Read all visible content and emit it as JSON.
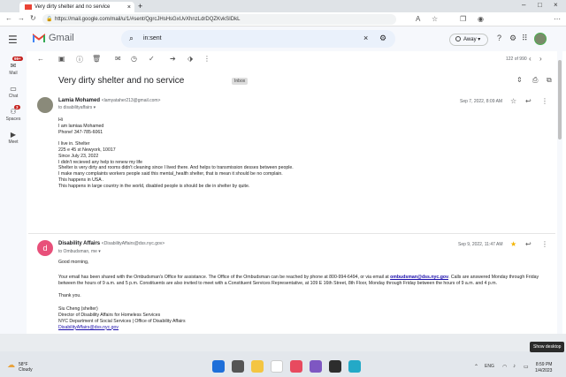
{
  "browser": {
    "tab_title": "Very dirty shelter and no service",
    "url": "https://mail.google.com/mail/u/1/#sent/QgrcJHsHsGxUvXhnzLdrDQZKvkSIDkL"
  },
  "gmail": {
    "product_name": "Gmail",
    "search_query": "in:sent",
    "status_label": "Away",
    "rail": {
      "mail_label": "Mail",
      "mail_badge": "99+",
      "chat_label": "Chat",
      "spaces_label": "Spaces",
      "spaces_badge": "3",
      "meet_label": "Meet"
    },
    "page_count": "122 of 990",
    "subject": "Very dirty shelter and no service",
    "subject_tag": "Inbox",
    "messages": [
      {
        "sender_name": "Lamia Mohamed",
        "sender_email": "<lamyataher213@gmail.com>",
        "to": "to disabilityaffairs",
        "date": "Sep 7, 2022, 8:09 AM",
        "body": [
          "Hi",
          "I am lamiaa Mohamed",
          "Phone! 347-785-6061",
          "",
          "I live in. Shelter",
          "225 e 45 st Newyork, 10017",
          "Since July 23, 2022",
          "I didn't recieved any help to renew my life",
          "Shelter is very dirty and rooms didn't cleaning since I lived there. And helps to transmission desses between people.",
          "I make many complaints workers people said this mental_health shelter,  that is mean it should be no complain.",
          "This happens in USA .",
          "This happens in large country in the world,  disabled people is should be die in shelter by quite."
        ]
      },
      {
        "sender_name": "Disability Affairs",
        "sender_email": "<DisabilityAffairs@dss.nyc.gov>",
        "avatar_letter": "d",
        "to": "to Ombudsman, me",
        "date": "Sep 9, 2022, 11:47 AM",
        "greeting": "Good morning,",
        "para_start": "Your email has been shared with the Ombudsman's Office for assistance.  The Office of the Ombudsman can be reached by phone at 800-994-6494, or via email at ",
        "para_link": "ombudsman@dss.nyc.gov",
        "para_end": ". Calls are answered Monday through Friday between the hours of 9 a.m. and 5 p.m. Constituents are also invited to meet with a Constituent Services Representative, at 109 E 16th Street, 8th Floor, Monday through Friday between the hours of 9 a.m. and 4 p.m.",
        "thanks": "Thank you.",
        "sig_name": "Siu Cheng (shelter)",
        "sig_title": "Director of Disability Affairs for Homeless Services",
        "sig_org": "NYC Department of Social Services | Office of Disability Affairs",
        "sig_email": "DisabilityAffairs@dss.nyc.gov"
      }
    ]
  },
  "taskbar": {
    "temperature": "58°F",
    "weather": "Cloudy",
    "language": "ENG",
    "time": "8:59 PM",
    "date": "1/4/2023",
    "tooltip": "Show desktop"
  }
}
